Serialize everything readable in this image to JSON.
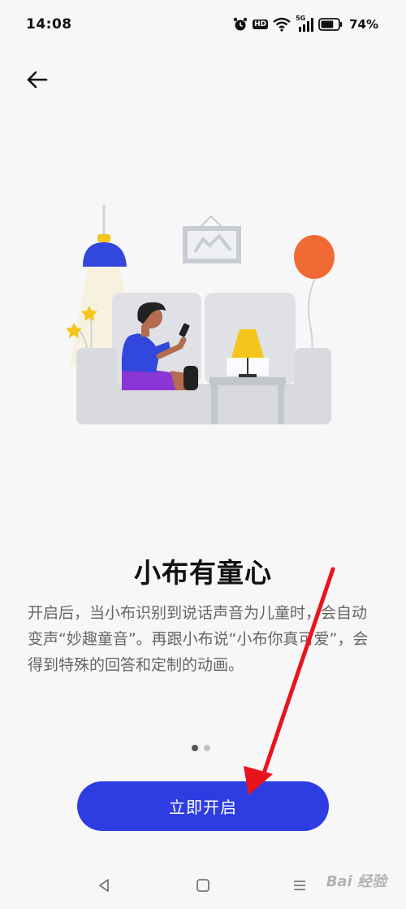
{
  "status_bar": {
    "time": "14:08",
    "hd_label": "HD",
    "network_label": "5G",
    "battery_percent": "74%",
    "battery_level": 0.74
  },
  "onboarding": {
    "title": "小布有童心",
    "description": "开启后，当小布识别到说话声音为儿童时，会自动变声“妙趣童音”。再跟小布说“小布你真可爱”，会得到特殊的回答和定制的动画。",
    "page_count": 2,
    "current_page": 1,
    "cta_label": "立即开启"
  },
  "watermark": {
    "text": "Bai 经验"
  },
  "colors": {
    "accent": "#2d3de2",
    "annotation_arrow": "#e8141c",
    "balloon": "#f06a35",
    "lamp": "#f5c51b",
    "pants": "#8a35d6",
    "shirt": "#3247db"
  }
}
